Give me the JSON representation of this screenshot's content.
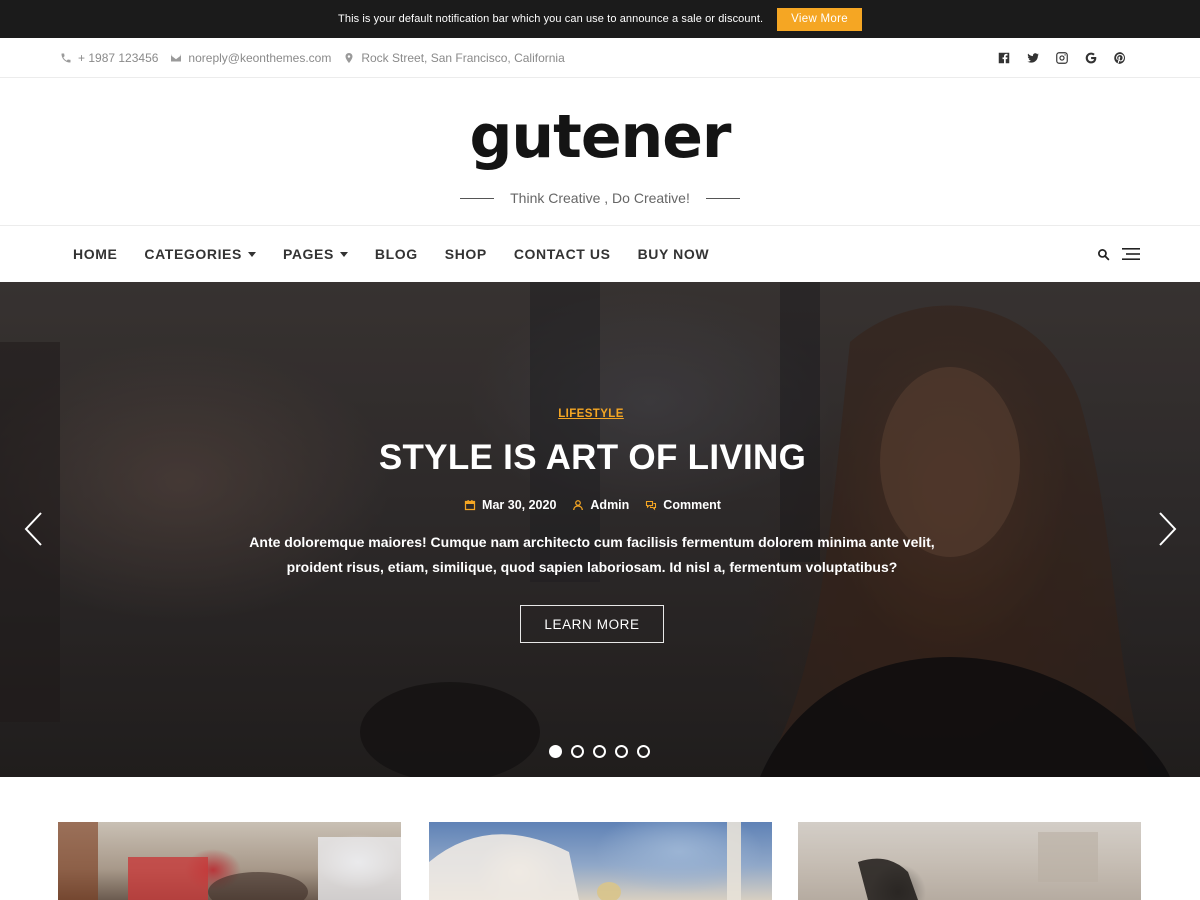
{
  "notification": {
    "text": "This is your default notification bar which you can use to announce a sale or discount.",
    "button_label": "View More",
    "accent_color": "#f5a623"
  },
  "topbar": {
    "phone": "+ 1987 123456",
    "email": "noreply@keonthemes.com",
    "address": "Rock Street, San Francisco, California",
    "social_icons": [
      "facebook-icon",
      "twitter-icon",
      "instagram-icon",
      "google-icon",
      "pinterest-icon"
    ]
  },
  "brand": {
    "logo_text": "gutener",
    "tagline": "Think Creative , Do Creative!"
  },
  "nav": {
    "items": [
      {
        "label": "HOME",
        "dropdown": false
      },
      {
        "label": "CATEGORIES",
        "dropdown": true
      },
      {
        "label": "PAGES",
        "dropdown": true
      },
      {
        "label": "BLOG",
        "dropdown": false
      },
      {
        "label": "SHOP",
        "dropdown": false
      },
      {
        "label": "CONTACT US",
        "dropdown": false
      },
      {
        "label": "BUY NOW",
        "dropdown": false
      }
    ],
    "tools": [
      "search-icon",
      "hamburger-menu-icon"
    ]
  },
  "hero": {
    "category": "LIFESTYLE",
    "title": "STYLE IS ART OF LIVING",
    "date": "Mar 30, 2020",
    "author": "Admin",
    "comments": "Comment",
    "excerpt": "Ante doloremque maiores! Cumque nam architecto cum facilisis fermentum dolorem minima ante velit, proident risus, etiam, similique, quod sapien laboriosam. Id nisl a, fermentum voluptatibus?",
    "button_label": "LEARN MORE",
    "slide_count": 5,
    "active_slide": 1
  },
  "cards": {
    "count": 3
  }
}
